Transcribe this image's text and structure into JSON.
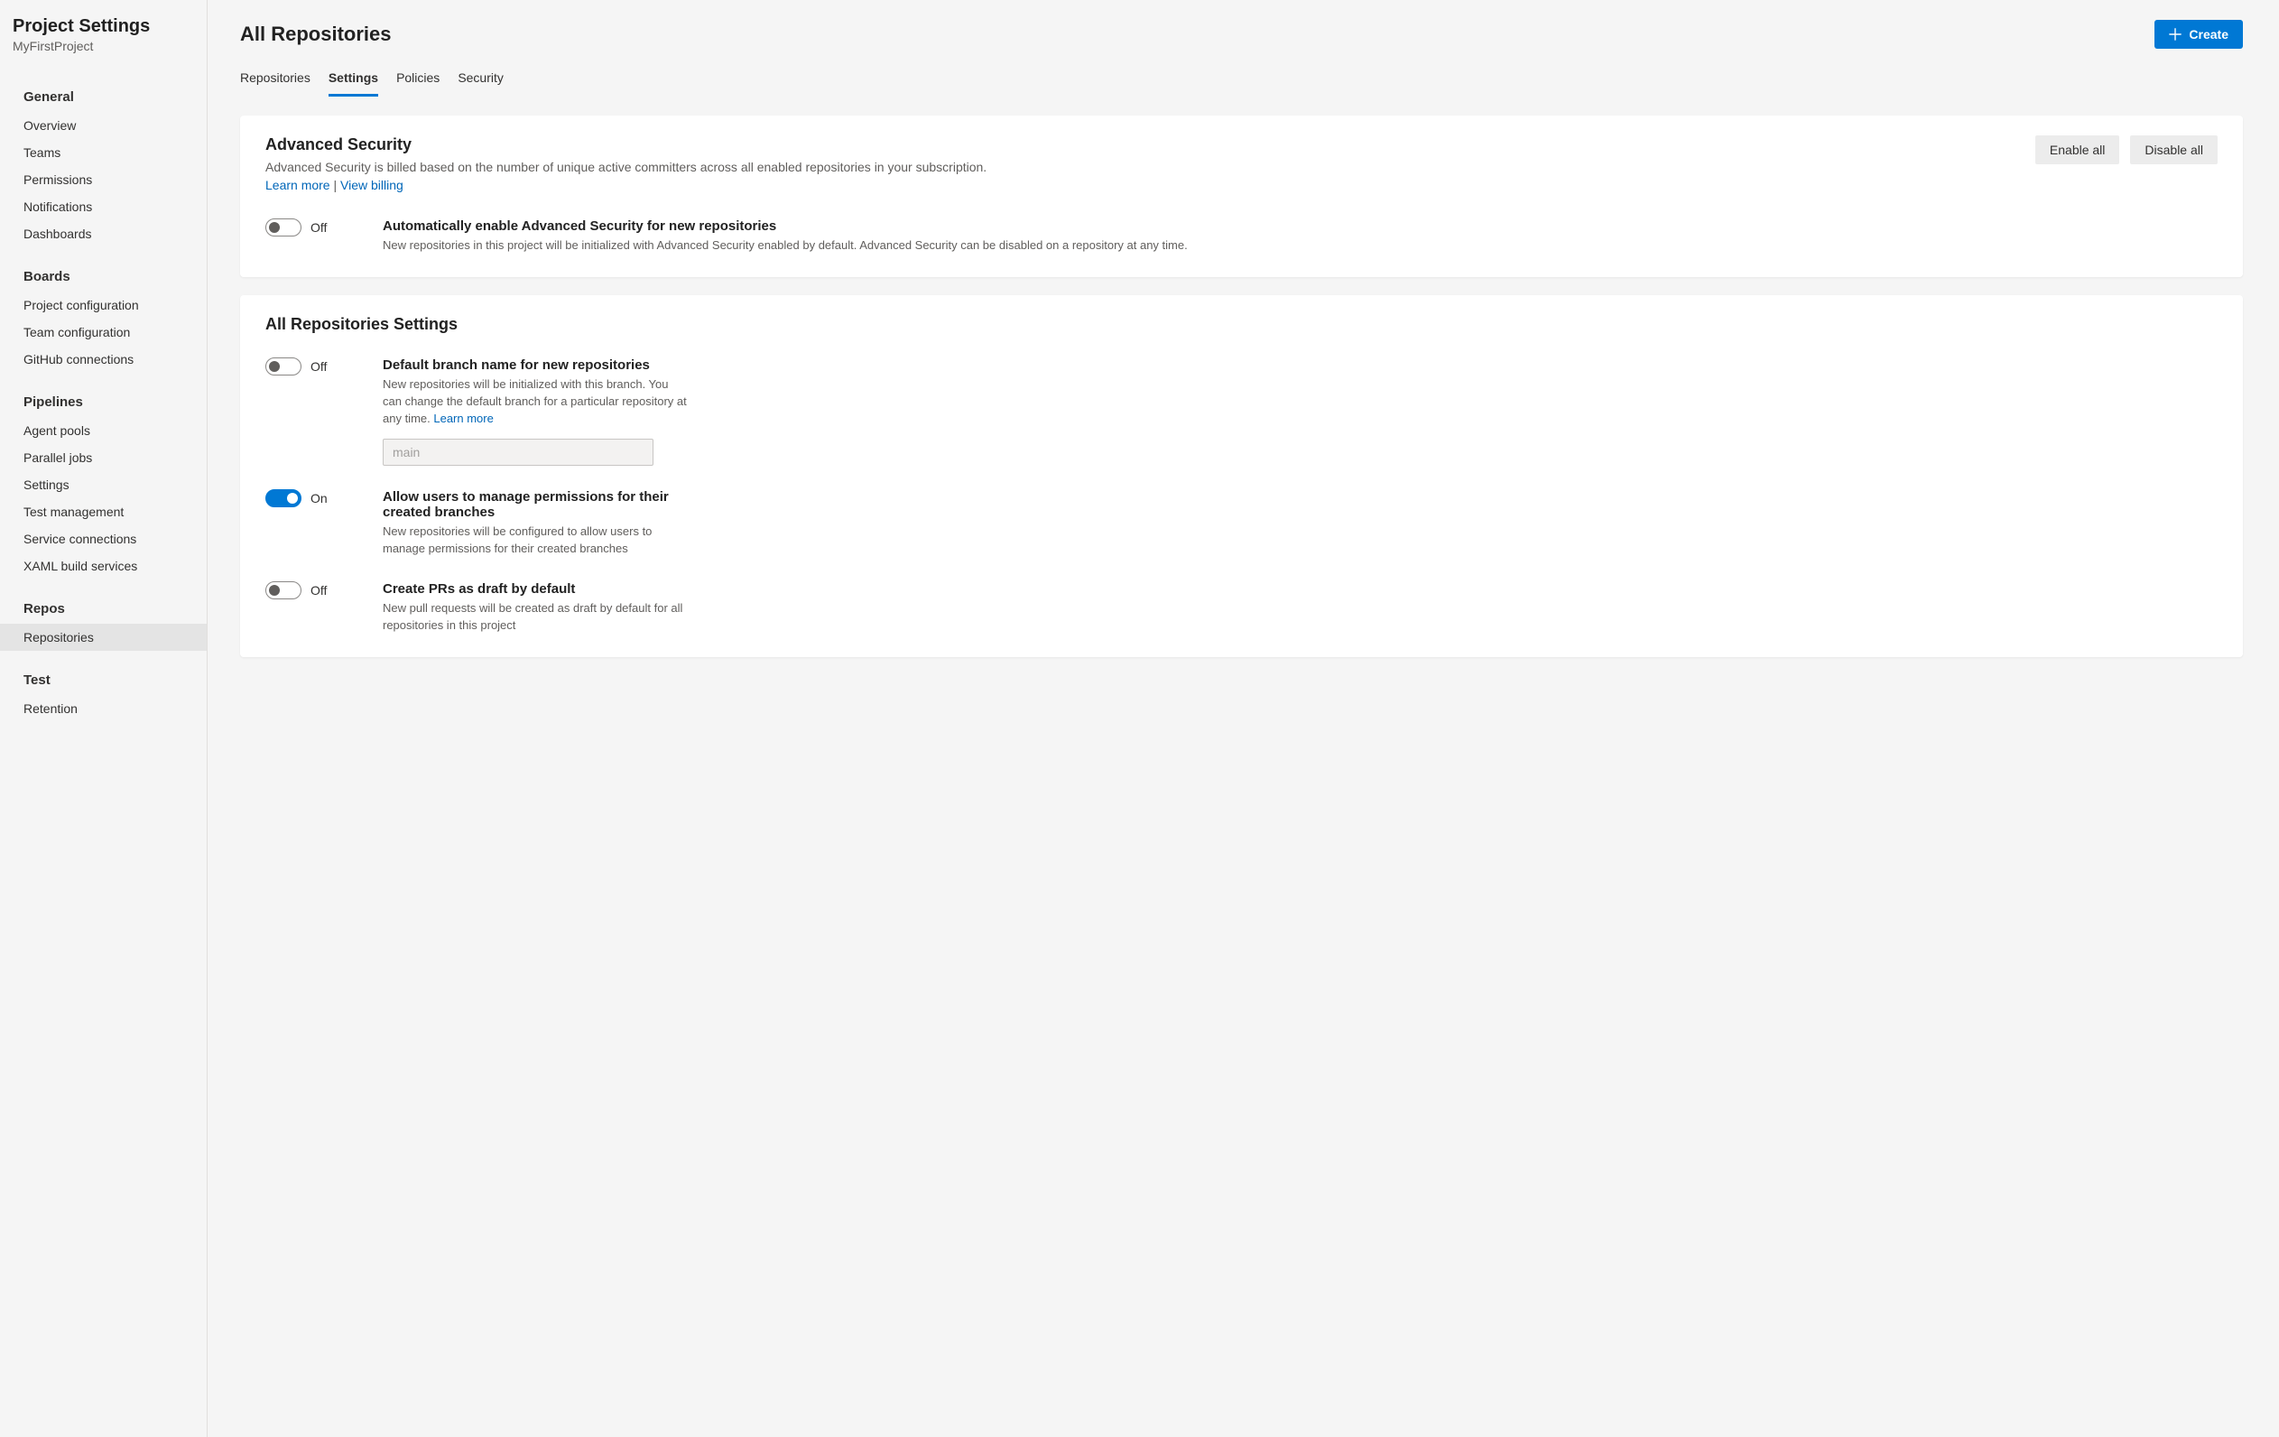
{
  "sidebar": {
    "title": "Project Settings",
    "subtitle": "MyFirstProject",
    "groups": [
      {
        "title": "General",
        "items": [
          {
            "label": "Overview",
            "selected": false
          },
          {
            "label": "Teams",
            "selected": false
          },
          {
            "label": "Permissions",
            "selected": false
          },
          {
            "label": "Notifications",
            "selected": false
          },
          {
            "label": "Dashboards",
            "selected": false
          }
        ]
      },
      {
        "title": "Boards",
        "items": [
          {
            "label": "Project configuration",
            "selected": false
          },
          {
            "label": "Team configuration",
            "selected": false
          },
          {
            "label": "GitHub connections",
            "selected": false
          }
        ]
      },
      {
        "title": "Pipelines",
        "items": [
          {
            "label": "Agent pools",
            "selected": false
          },
          {
            "label": "Parallel jobs",
            "selected": false
          },
          {
            "label": "Settings",
            "selected": false
          },
          {
            "label": "Test management",
            "selected": false
          },
          {
            "label": "Service connections",
            "selected": false
          },
          {
            "label": "XAML build services",
            "selected": false
          }
        ]
      },
      {
        "title": "Repos",
        "items": [
          {
            "label": "Repositories",
            "selected": true
          }
        ]
      },
      {
        "title": "Test",
        "items": [
          {
            "label": "Retention",
            "selected": false
          }
        ]
      }
    ]
  },
  "header": {
    "page_title": "All Repositories",
    "create_label": "Create"
  },
  "tabs": [
    {
      "label": "Repositories",
      "active": false
    },
    {
      "label": "Settings",
      "active": true
    },
    {
      "label": "Policies",
      "active": false
    },
    {
      "label": "Security",
      "active": false
    }
  ],
  "advanced_security": {
    "title": "Advanced Security",
    "description": "Advanced Security is billed based on the number of unique active committers across all enabled repositories in your subscription.",
    "learn_more": "Learn more",
    "separator": " | ",
    "view_billing": "View billing",
    "enable_all": "Enable all",
    "disable_all": "Disable all",
    "auto_enable": {
      "state": "Off",
      "on": false,
      "title": "Automatically enable Advanced Security for new repositories",
      "desc": "New repositories in this project will be initialized with Advanced Security enabled by default. Advanced Security can be disabled on a repository at any time."
    }
  },
  "repo_settings": {
    "title": "All Repositories Settings",
    "default_branch": {
      "state": "Off",
      "on": false,
      "title": "Default branch name for new repositories",
      "desc": "New repositories will be initialized with this branch. You can change the default branch for a particular repository at any time. ",
      "learn_more": "Learn more",
      "placeholder": "main",
      "value": ""
    },
    "manage_perms": {
      "state": "On",
      "on": true,
      "title": "Allow users to manage permissions for their created branches",
      "desc": "New repositories will be configured to allow users to manage permissions for their created branches"
    },
    "draft_prs": {
      "state": "Off",
      "on": false,
      "title": "Create PRs as draft by default",
      "desc": "New pull requests will be created as draft by default for all repositories in this project"
    }
  }
}
